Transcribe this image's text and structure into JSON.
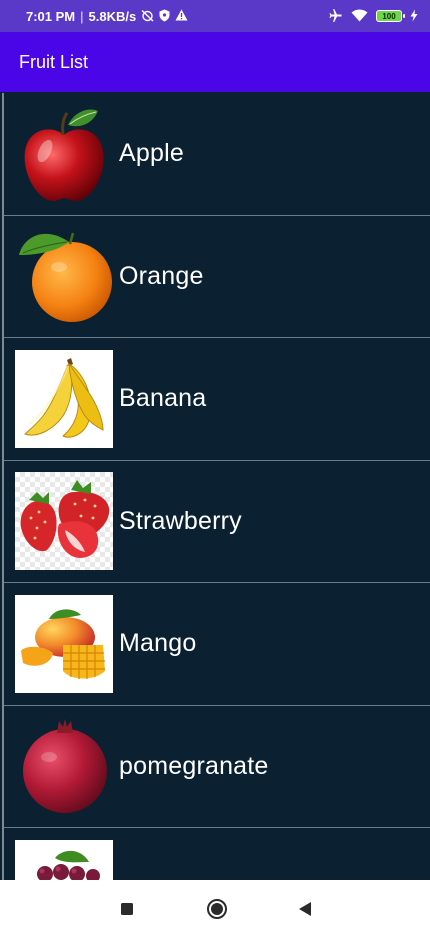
{
  "status_bar": {
    "time": "7:01 PM",
    "separator": "|",
    "network_speed": "5.8KB/s",
    "battery_level": "100",
    "icons": [
      "alarm-off-icon",
      "vpn-shield-icon",
      "warning-icon",
      "airplane-icon",
      "wifi-icon",
      "battery-icon",
      "charging-icon"
    ]
  },
  "app_bar": {
    "title": "Fruit List"
  },
  "fruits": [
    {
      "name": "Apple",
      "icon": "apple-icon"
    },
    {
      "name": "Orange",
      "icon": "orange-icon"
    },
    {
      "name": "Banana",
      "icon": "banana-icon"
    },
    {
      "name": "Strawberry",
      "icon": "strawberry-icon"
    },
    {
      "name": "Mango",
      "icon": "mango-icon"
    },
    {
      "name": "pomegranate",
      "icon": "pomegranate-icon"
    },
    {
      "name": "",
      "icon": "grapes-icon"
    }
  ],
  "nav_bar": {
    "buttons": [
      "recents-button",
      "home-button",
      "back-button"
    ]
  },
  "colors": {
    "status_bar": "#5a39c9",
    "app_bar": "#4a06e6",
    "list_background": "#0b2131",
    "divider": "#6b7c86",
    "text": "#ffffff",
    "nav_bar": "#ffffff"
  }
}
